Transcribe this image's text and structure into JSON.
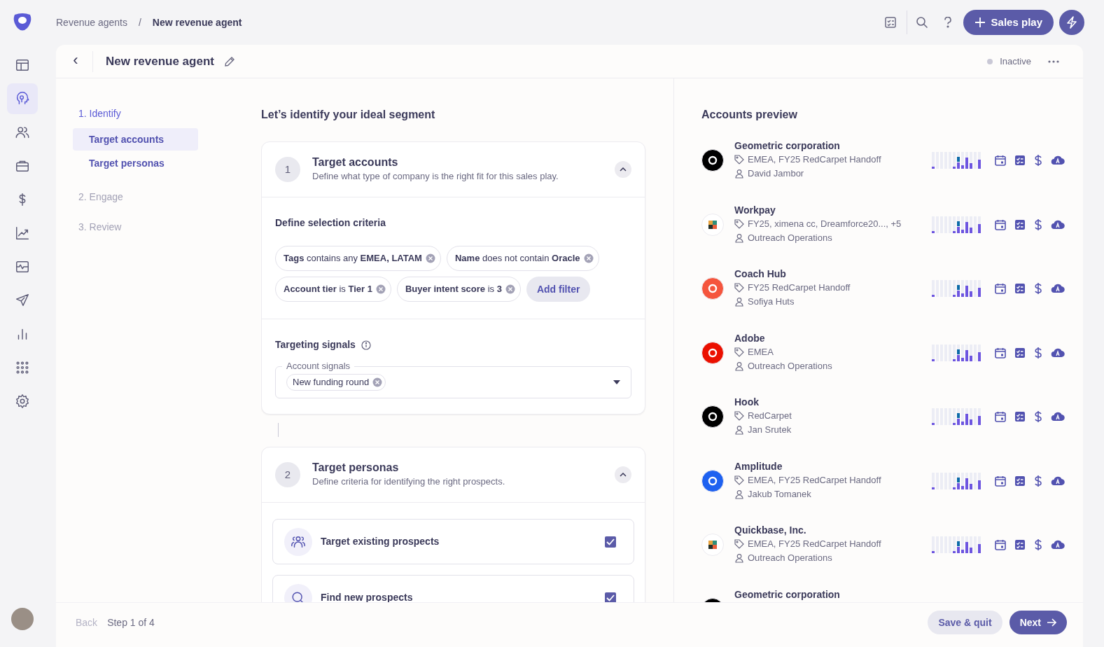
{
  "breadcrumb": {
    "parent": "Revenue agents",
    "separator": "/",
    "current": "New revenue agent"
  },
  "topbar": {
    "primary_button": "Sales play"
  },
  "nav_items": [
    {
      "selected": false
    },
    {
      "selected": true
    },
    {
      "selected": false
    },
    {
      "selected": false
    },
    {
      "selected": false
    },
    {
      "selected": false
    },
    {
      "selected": false
    },
    {
      "selected": false
    },
    {
      "selected": false
    },
    {
      "selected": false
    },
    {
      "selected": false
    }
  ],
  "header": {
    "back": "‹",
    "title": "New revenue agent",
    "status": "Inactive",
    "status_active": false
  },
  "steps": [
    {
      "label": "1. Identify",
      "active": true,
      "children": [
        {
          "label": "Target accounts",
          "selected": true
        },
        {
          "label": "Target personas",
          "selected": false
        }
      ]
    },
    {
      "label": "2. Engage",
      "active": false
    },
    {
      "label": "3. Review",
      "active": false
    }
  ],
  "heading": "Let’s identify your ideal segment",
  "sections": [
    {
      "number": "1",
      "title": "Target accounts",
      "description": "Define what type of company is the right fit for this sales play.",
      "expanded": true,
      "criteria_title": "Define selection criteria",
      "filters": [
        "**Tags** contains any **EMEA, LATAM**",
        "**Name** does not contain **Oracle**",
        "**Account tier** is **Tier 1**",
        "**Buyer intent score** is **3**"
      ],
      "add_filter": "Add filter",
      "signals_title": "Targeting signals",
      "signals_field": {
        "label": "Account signals",
        "values": [
          "New funding round"
        ]
      }
    },
    {
      "number": "2",
      "title": "Target personas",
      "description": "Define criteria for identifying the right prospects.",
      "expanded": true,
      "options": [
        {
          "kind": "people",
          "label": "Target existing prospects",
          "checked": true
        },
        {
          "kind": "search",
          "label": "Find new prospects",
          "checked": true
        }
      ]
    }
  ],
  "preview": {
    "title": "Accounts preview",
    "accounts": [
      {
        "name": "Geometric corporation",
        "tags": "EMEA, FY25 RedCarpet Handoff",
        "owner": "David Jambor",
        "color": "#000000"
      },
      {
        "name": "Workpay",
        "tags": "FY25, ximena cc, Dreamforce20..., +5",
        "owner": "Outreach Operations",
        "color": "#ffffff"
      },
      {
        "name": "Coach Hub",
        "tags": "FY25 RedCarpet Handoff",
        "owner": "Sofiya Huts",
        "color": "#f5553d"
      },
      {
        "name": "Adobe",
        "tags": "EMEA",
        "owner": "Outreach Operations",
        "color": "#eb1000"
      },
      {
        "name": "Hook",
        "tags": "RedCarpet",
        "owner": "Jan Srutek",
        "color": "#000000"
      },
      {
        "name": "Amplitude",
        "tags": "EMEA, FY25 RedCarpet Handoff",
        "owner": "Jakub Tomanek",
        "color": "#1e61f0"
      },
      {
        "name": "Quickbase, Inc.",
        "tags": "EMEA, FY25 RedCarpet Handoff",
        "owner": "Outreach Operations",
        "color": "#ffffff"
      },
      {
        "name": "Geometric corporation",
        "color": "#000000"
      }
    ]
  },
  "footer": {
    "back": "Back",
    "back_disabled": true,
    "step": "Step 1 of 4",
    "save": "Save & quit",
    "next": "Next"
  }
}
